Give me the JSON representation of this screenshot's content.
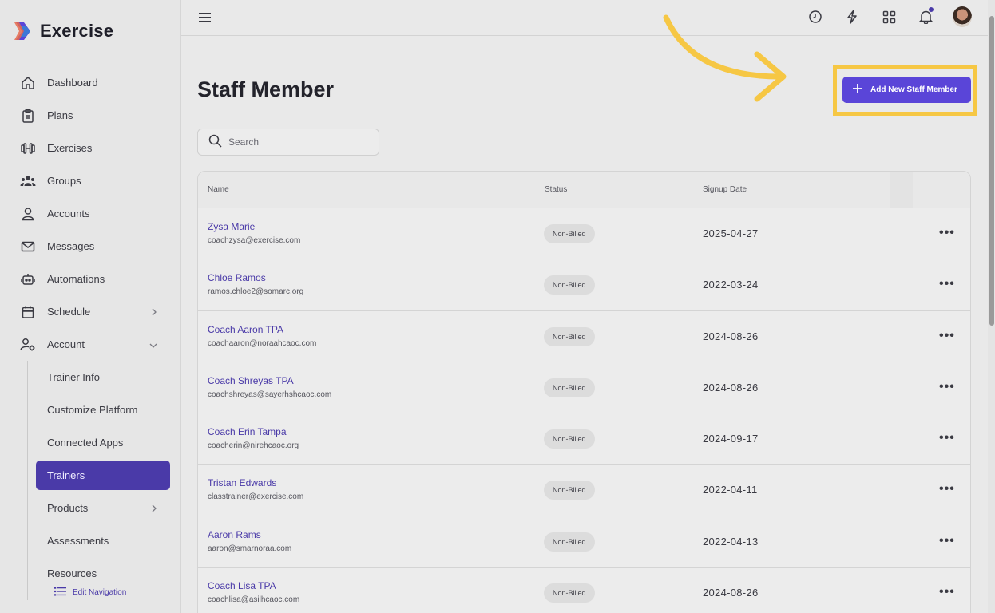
{
  "app": {
    "name": "Exercise"
  },
  "sidebar": {
    "items": [
      {
        "label": "Dashboard",
        "icon": "home-icon"
      },
      {
        "label": "Plans",
        "icon": "clipboard-icon"
      },
      {
        "label": "Exercises",
        "icon": "dumbbell-icon"
      },
      {
        "label": "Groups",
        "icon": "users-icon"
      },
      {
        "label": "Accounts",
        "icon": "user-icon"
      },
      {
        "label": "Messages",
        "icon": "mail-icon"
      },
      {
        "label": "Automations",
        "icon": "robot-icon"
      },
      {
        "label": "Schedule",
        "icon": "calendar-icon"
      },
      {
        "label": "Account",
        "icon": "user-gear-icon"
      }
    ],
    "subitems": [
      {
        "label": "Trainer Info"
      },
      {
        "label": "Customize Platform"
      },
      {
        "label": "Connected Apps"
      },
      {
        "label": "Trainers"
      },
      {
        "label": "Products"
      },
      {
        "label": "Assessments"
      },
      {
        "label": "Resources"
      }
    ],
    "edit_nav": "Edit Navigation"
  },
  "page": {
    "title": "Staff Member",
    "add_button": "Add New Staff Member",
    "search_placeholder": "Search"
  },
  "table": {
    "headers": {
      "name": "Name",
      "status": "Status",
      "signup": "Signup Date"
    },
    "rows": [
      {
        "name": "Zysa Marie",
        "email": "coachzysa@exercise.com",
        "status": "Non-Billed",
        "date": "2025-04-27"
      },
      {
        "name": "Chloe Ramos",
        "email": "ramos.chloe2@somarc.org",
        "status": "Non-Billed",
        "date": "2022-03-24"
      },
      {
        "name": "Coach Aaron TPA",
        "email": "coachaaron@noraahcaoc.com",
        "status": "Non-Billed",
        "date": "2024-08-26"
      },
      {
        "name": "Coach Shreyas TPA",
        "email": "coachshreyas@sayerhshcaoc.com",
        "status": "Non-Billed",
        "date": "2024-08-26"
      },
      {
        "name": "Coach Erin Tampa",
        "email": "coacherin@nirehcaoc.org",
        "status": "Non-Billed",
        "date": "2024-09-17"
      },
      {
        "name": "Tristan Edwards",
        "email": "classtrainer@exercise.com",
        "status": "Non-Billed",
        "date": "2022-04-11"
      },
      {
        "name": "Aaron Rams",
        "email": "aaron@smarnoraa.com",
        "status": "Non-Billed",
        "date": "2022-04-13"
      },
      {
        "name": "Coach Lisa TPA",
        "email": "coachlisa@asilhcaoc.com",
        "status": "Non-Billed",
        "date": "2024-08-26"
      }
    ],
    "more_label": "•••"
  },
  "colors": {
    "accent": "#5a45d8",
    "active_nav": "#4a3aa8",
    "highlight": "#f6c744"
  }
}
